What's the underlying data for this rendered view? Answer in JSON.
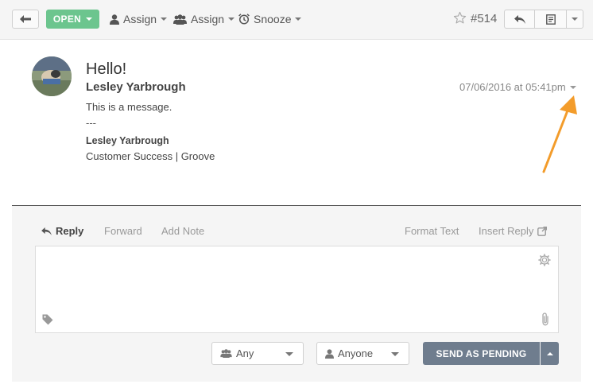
{
  "toolbar": {
    "status_label": "OPEN",
    "assign_agent_label": "Assign",
    "assign_group_label": "Assign",
    "snooze_label": "Snooze",
    "ticket_number": "#514"
  },
  "message": {
    "subject": "Hello!",
    "author": "Lesley Yarbrough",
    "date": "07/06/2016 at 05:41pm",
    "body": "This is a message.",
    "separator": "---",
    "signature_name": "Lesley Yarbrough",
    "signature_title": "Customer Success | Groove"
  },
  "composer": {
    "tabs": {
      "reply": "Reply",
      "forward": "Forward",
      "add_note": "Add Note",
      "format_text": "Format Text",
      "insert_reply": "Insert Reply"
    },
    "group_select": "Any",
    "agent_select": "Anyone",
    "send_label": "SEND AS PENDING"
  },
  "colors": {
    "open_green": "#6cc58e",
    "send_slate": "#6f7d8e",
    "annotation_arrow": "#f39c2b"
  },
  "icons": [
    "back-arrow-icon",
    "user-icon",
    "group-icon",
    "alarm-clock-icon",
    "star-icon",
    "reply-icon",
    "note-icon",
    "gear-icon",
    "tag-icon",
    "paperclip-icon",
    "external-link-icon"
  ]
}
